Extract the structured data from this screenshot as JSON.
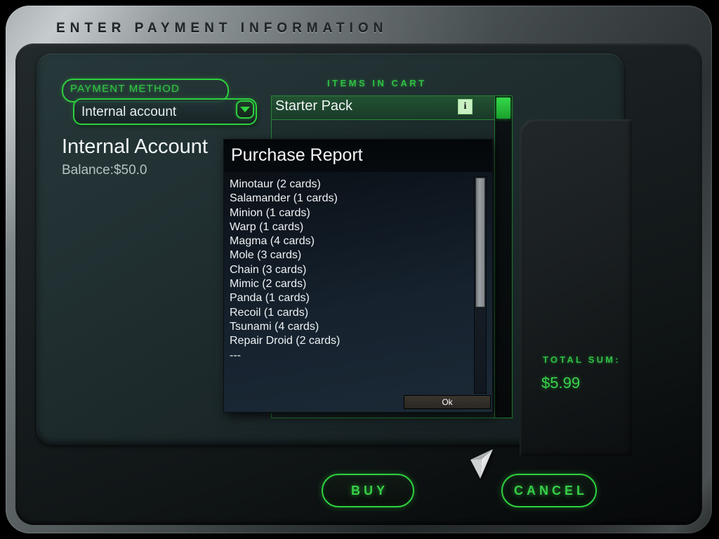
{
  "window": {
    "title": "ENTER PAYMENT INFORMATION"
  },
  "payment_method": {
    "group_label": "PAYMENT METHOD",
    "selected_value": "Internal account",
    "dropdown_icon": "chevron-down-icon"
  },
  "account": {
    "name": "Internal Account",
    "balance": "Balance:$50.0"
  },
  "cart": {
    "header": "ITEMS IN CART",
    "items": [
      {
        "label": "Starter Pack",
        "info_icon": "info-icon",
        "selected": true
      }
    ]
  },
  "total": {
    "label": "TOTAL SUM:",
    "value": "$5.99"
  },
  "actions": {
    "buy_label": "BUY",
    "cancel_label": "CANCEL"
  },
  "dialog": {
    "title": "Purchase Report",
    "ok_label": "Ok",
    "lines": [
      "Minotaur (2 cards)",
      "Salamander (1 cards)",
      "Minion (1 cards)",
      "Warp (1 cards)",
      "Magma (4 cards)",
      "Mole (3 cards)",
      "Chain (3 cards)",
      "Mimic (2 cards)",
      "Panda (1 cards)",
      "Recoil (1 cards)",
      "Tsunami (4 cards)",
      "Repair Droid (2 cards)",
      "---"
    ]
  },
  "colors": {
    "accent_green": "#2ecf3e",
    "text_light": "#f0f4f5",
    "panel_teal": "#22312f",
    "dialog_blue": "#16222e"
  },
  "cursor": {
    "icon": "mouse-pointer-icon"
  }
}
